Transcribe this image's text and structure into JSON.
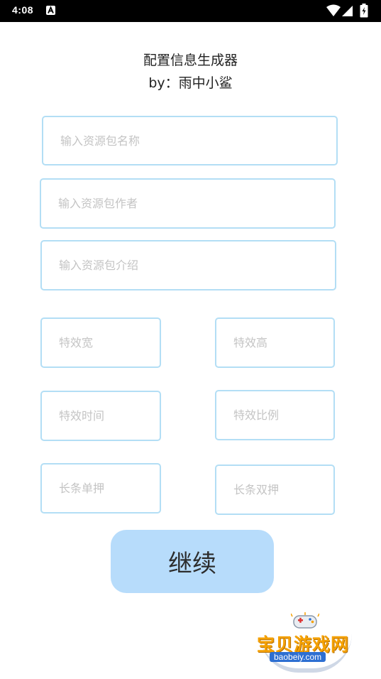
{
  "status_bar": {
    "time": "4:08",
    "icons": [
      "notification-a-icon",
      "wifi-icon",
      "signal-icon",
      "battery-icon"
    ]
  },
  "header": {
    "title": "配置信息生成器",
    "author": "by：雨中小鲨"
  },
  "form": {
    "name_placeholder": "输入资源包名称",
    "author_placeholder": "输入资源包作者",
    "intro_placeholder": "输入资源包介绍",
    "effect_width_placeholder": "特效宽",
    "effect_height_placeholder": "特效高",
    "effect_time_placeholder": "特效时间",
    "effect_ratio_placeholder": "特效比例",
    "long_single_placeholder": "长条单押",
    "long_double_placeholder": "长条双押"
  },
  "actions": {
    "continue_label": "继续"
  },
  "watermark": {
    "text": "宝贝游戏网",
    "url": "baobeiy.com"
  },
  "colors": {
    "input_border": "#b3def5",
    "button_bg": "#b7dcfb",
    "status_bar_bg": "#000000"
  }
}
